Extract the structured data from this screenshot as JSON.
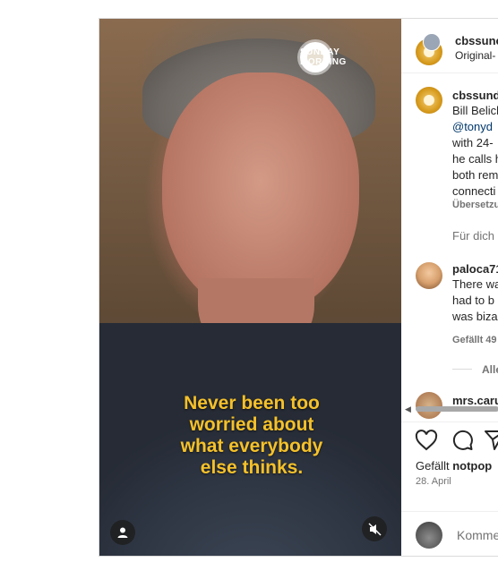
{
  "video": {
    "logo": {
      "line1": "SUNDAY",
      "line2": "MORNING"
    },
    "caption": [
      "Never been too",
      "worried about",
      "what everybody",
      "else thinks."
    ],
    "profile_icon": "user-icon",
    "mute_icon": "muted-speaker-icon"
  },
  "header": {
    "username": "cbssunc",
    "subtitle": "Original-"
  },
  "post": {
    "username": "cbssund",
    "lines": [
      "Bill Belich",
      "@tonyd",
      "with 24-",
      "he calls h",
      "both rem",
      "connecti"
    ],
    "translate": "Übersetzu"
  },
  "reply_prompt": "Für dich",
  "comments": [
    {
      "username": "paloca71",
      "lines": [
        "There wa",
        "had to b",
        "was biza"
      ],
      "meta": "Gefällt 49"
    },
    {
      "username": "mrs.caru"
    }
  ],
  "view_replies": "Alle",
  "actions": {
    "like": "heart-icon",
    "comment": "comment-icon",
    "share": "paper-plane-icon"
  },
  "likes": {
    "prefix": "Gefällt ",
    "user": "notpop"
  },
  "date": "28. April",
  "comment_placeholder": "Komme",
  "colors": {
    "caption": "#f5c12a",
    "link": "#00376b",
    "muted": "#737373"
  }
}
